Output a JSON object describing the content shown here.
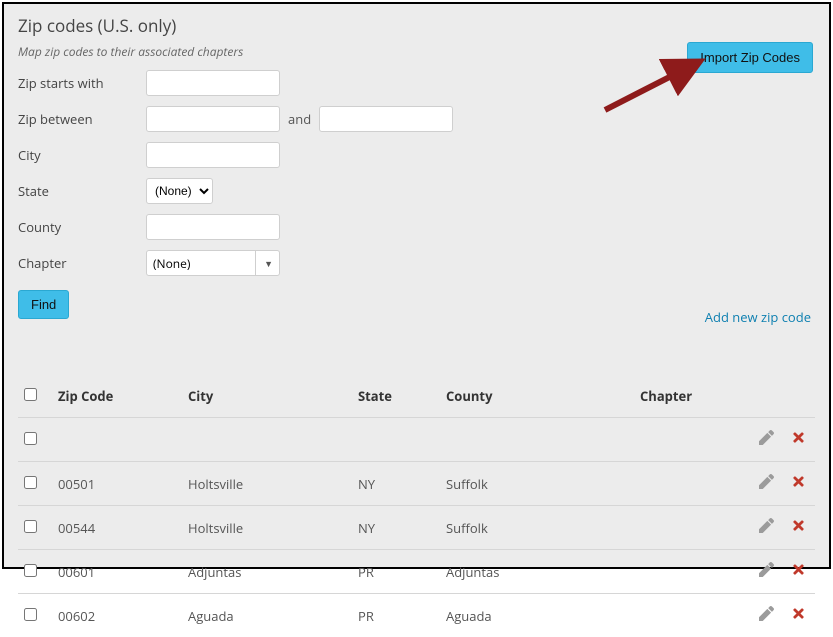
{
  "header": {
    "title": "Zip codes (U.S. only)",
    "subtitle": "Map zip codes to their associated chapters",
    "import_label": "Import Zip Codes"
  },
  "form": {
    "zip_starts_label": "Zip starts with",
    "zip_between_label": "Zip between",
    "and_label": "and",
    "city_label": "City",
    "state_label": "State",
    "state_value": "(None)",
    "county_label": "County",
    "chapter_label": "Chapter",
    "chapter_value": "(None)",
    "find_label": "Find"
  },
  "actions": {
    "add_new_label": "Add new zip code"
  },
  "table": {
    "headers": {
      "zip": "Zip Code",
      "city": "City",
      "state": "State",
      "county": "County",
      "chapter": "Chapter"
    },
    "rows": [
      {
        "zip": "",
        "city": "",
        "state": "",
        "county": "",
        "chapter": ""
      },
      {
        "zip": "00501",
        "city": "Holtsville",
        "state": "NY",
        "county": "Suffolk",
        "chapter": ""
      },
      {
        "zip": "00544",
        "city": "Holtsville",
        "state": "NY",
        "county": "Suffolk",
        "chapter": ""
      },
      {
        "zip": "00601",
        "city": "Adjuntas",
        "state": "PR",
        "county": "Adjuntas",
        "chapter": ""
      },
      {
        "zip": "00602",
        "city": "Aguada",
        "state": "PR",
        "county": "Aguada",
        "chapter": ""
      }
    ]
  }
}
